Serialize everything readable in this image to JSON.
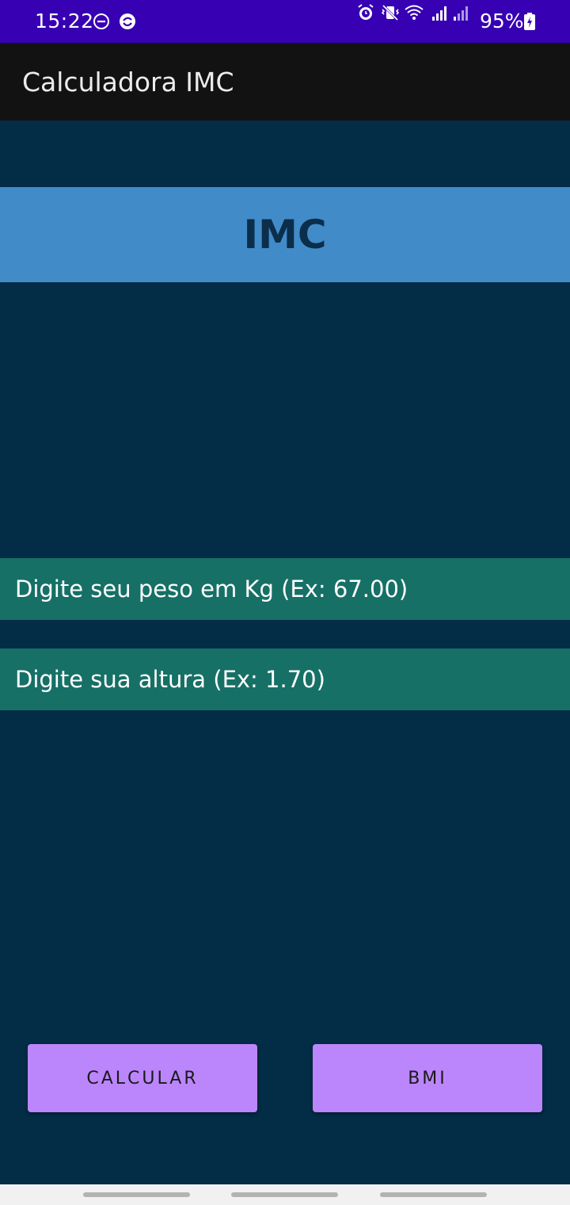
{
  "status_bar": {
    "time": "15:22",
    "battery": "95%",
    "background": "#3700b3",
    "icons": [
      "do-not-disturb-icon",
      "sync-icon",
      "alarm-icon",
      "vibrate-icon",
      "wifi-icon",
      "signal-icon",
      "signal-icon",
      "battery-charging-icon"
    ]
  },
  "app_bar": {
    "title": "Calculadora IMC",
    "background": "#121212"
  },
  "header": {
    "title": "IMC",
    "background": "#428bc9"
  },
  "form": {
    "weight_placeholder": "Digite seu peso em Kg (Ex: 67.00)",
    "height_placeholder": "Digite sua altura (Ex: 1.70)",
    "field_background": "#167066"
  },
  "buttons": {
    "calculate_label": "CALCULAR",
    "bmi_label": "BMI",
    "background": "#bb86fc"
  },
  "colors": {
    "page_background": "#032c46"
  }
}
